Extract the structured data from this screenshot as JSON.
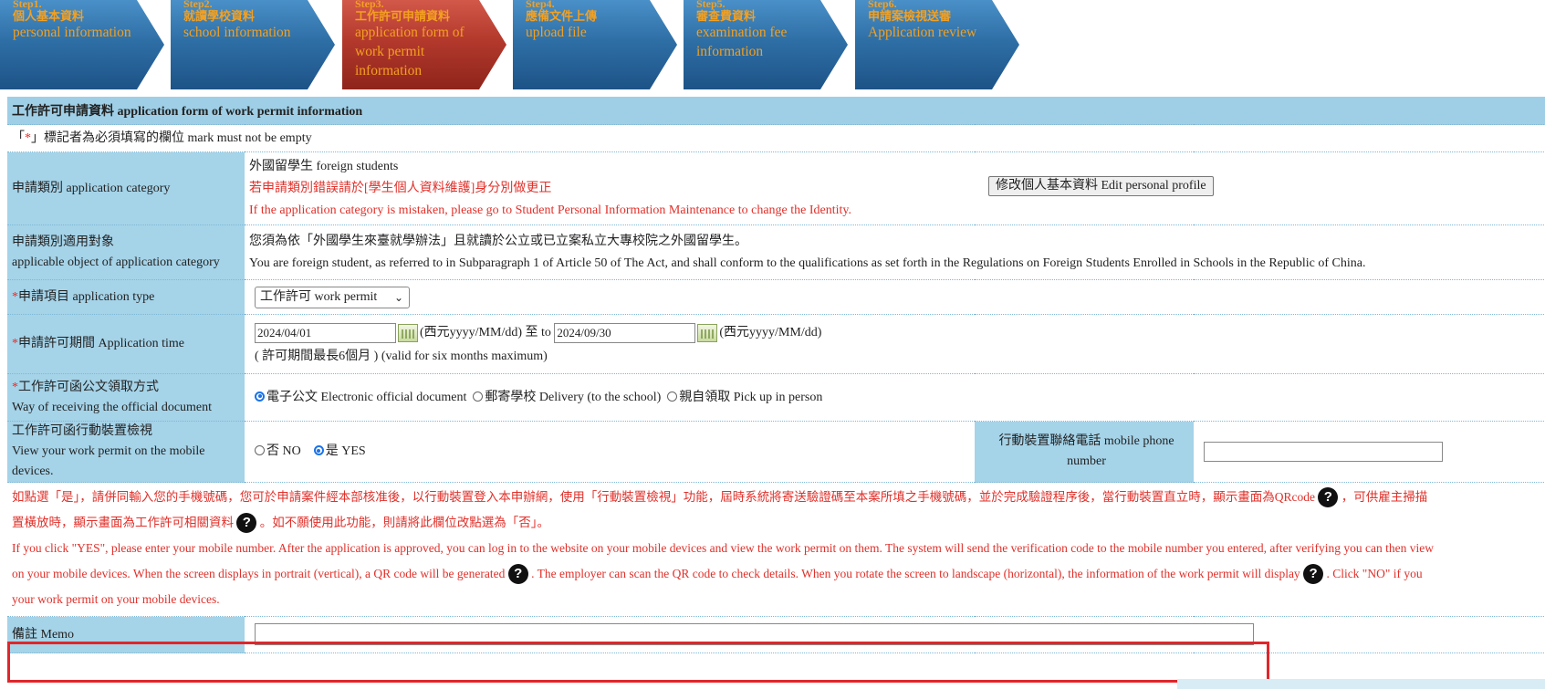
{
  "steps": [
    {
      "num": "Step1.",
      "zh": "個人基本資料",
      "en": "personal information"
    },
    {
      "num": "Step2.",
      "zh": "就讀學校資料",
      "en": "school information"
    },
    {
      "num": "Step3.",
      "zh": "工作許可申請資料",
      "en": "application form of work permit information"
    },
    {
      "num": "Step4.",
      "zh": "應備文件上傳",
      "en": "upload file"
    },
    {
      "num": "Step5.",
      "zh": "審查費資料",
      "en": "examination fee information"
    },
    {
      "num": "Step6.",
      "zh": "申請案檢視送審",
      "en": "Application review"
    }
  ],
  "form": {
    "header": "工作許可申請資料 application form of work permit information",
    "required_note_prefix": "「",
    "required_star": "*",
    "required_note_suffix": "」標記者為必須填寫的欄位 mark must not be empty",
    "category": {
      "label": "申請類別 application category",
      "value": "外國留學生 foreign students",
      "warn_zh": "若申請類別錯誤請於[學生個人資料維護]身分別做更正",
      "warn_en": "If the application category is mistaken, please go to Student Personal Information Maintenance to change the Identity.",
      "edit_button": "修改個人基本資料 Edit personal profile"
    },
    "object": {
      "label_zh": "申請類別適用對象",
      "label_en": "applicable object of application category",
      "text_zh": "您須為依「外國學生來臺就學辦法」且就讀於公立或已立案私立大專校院之外國留學生。",
      "text_en": "You are foreign student, as referred to in Subparagraph 1 of Article 50 of The Act, and shall conform to the qualifications as set forth in the Regulations on Foreign Students Enrolled in Schools in the Republic of China."
    },
    "type": {
      "star": "*",
      "label": "申請項目 application type",
      "selected": "工作許可 work permit"
    },
    "period": {
      "star": "*",
      "label": "申請許可期間 Application time",
      "start": "2024/04/01",
      "fmt1": "(西元yyyy/MM/dd)",
      "to": "至 to",
      "end": "2024/09/30",
      "fmt2": "(西元yyyy/MM/dd)",
      "hint": "( 許可期間最長6個月 ) (valid for six months maximum)"
    },
    "receive": {
      "star": "*",
      "label_zh": "工作許可函公文領取方式",
      "label_en": "Way of receiving the official document",
      "options": [
        "電子公文 Electronic official document",
        "郵寄學校 Delivery (to the school)",
        "親自領取 Pick up in person"
      ],
      "selected_index": 0
    },
    "mobile": {
      "label_zh": "工作許可函行動裝置檢視",
      "label_en": "View your work permit on the mobile devices.",
      "no": "否 NO",
      "yes": "是 YES",
      "selected": "yes",
      "phone_label": "行動裝置聯絡電話 mobile phone number",
      "phone_value": ""
    },
    "note": {
      "zh_1": "如點選「是」，請併同輸入您的手機號碼，您可於申請案件經本部核准後，以行動裝置登入本申辦網，使用「行動裝置檢視」功能，屆時系統將寄送驗證碼至本案所填之手機號碼，並於完成驗證程序後，當行動裝置直立時，顯示畫面為QRcode",
      "zh_2": "，可供雇主掃描",
      "zh_3": "置橫放時，顯示畫面為工作許可相關資料",
      "zh_4": "。如不願使用此功能，則請將此欄位改點選為「否」。",
      "en_1": "If you click \"YES\", please enter your mobile number. After the application is approved, you can log in to the website on your mobile devices and view the work permit on them. The system will send the verification code to the mobile number you entered, after verifying you can then view",
      "en_2": "on your mobile devices. When the screen displays in portrait (vertical), a QR code will be generated",
      "en_3": ". The employer can scan the QR code to check details. When you rotate the screen to landscape (horizontal), the information of the work permit will display",
      "en_4": ". Click \"NO\" if you",
      "en_5": "your work permit on your mobile devices.",
      "q": "?"
    },
    "memo": {
      "label": "備註 Memo",
      "value": ""
    }
  },
  "colors": {
    "step_blue": "#2e6fa6",
    "step_active_red": "#b3392c",
    "step_text": "#f4a020",
    "label_bg": "#a5d3e8",
    "warning": "#e0302a",
    "highlight": "#e0262a"
  }
}
